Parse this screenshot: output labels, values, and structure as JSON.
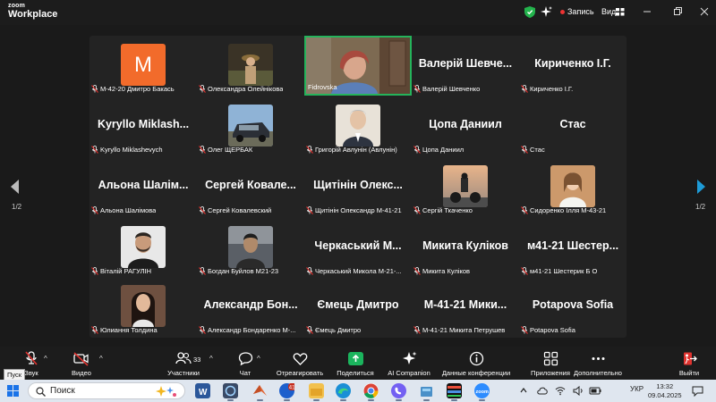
{
  "window": {
    "logo_small": "zoom",
    "logo_title": "Workplace",
    "recording_label": "Запись",
    "view_label": "Вид"
  },
  "gallery": {
    "page_indicator_left": "1/2",
    "page_indicator_right": "1/2",
    "tiles": [
      {
        "name": "М-42-20 Дмитро Бакась",
        "avatar": "letter",
        "letter": "M",
        "color": "#f26b2b"
      },
      {
        "name": "Олександра Олейнікова",
        "avatar": "photo-woman-hat"
      },
      {
        "name": "Fidrovska",
        "avatar": "video"
      },
      {
        "name": "Валерій Шевченко",
        "big": "Валерій Шевче..."
      },
      {
        "name": "Кириченко І.Г.",
        "big": "Кириченко І.Г."
      },
      {
        "name": "Kyryllo Miklashevych",
        "big": "Kyryllo Miklash..."
      },
      {
        "name": "Олег ЩЕРБАК",
        "avatar": "photo-car"
      },
      {
        "name": "Григорій Авлунін (Авлунін)",
        "avatar": "photo-man-grey"
      },
      {
        "name": "Цопа Даниил",
        "big": "Цопа Даниил"
      },
      {
        "name": "Стас",
        "big": "Стас"
      },
      {
        "name": "Альона Шалімова",
        "big": "Альона Шалім..."
      },
      {
        "name": "Сергей Ковалевский",
        "big": "Сергей Ковале..."
      },
      {
        "name": "Щитінін Олександр М-41-21",
        "big": "Щитінін Олекс..."
      },
      {
        "name": "Сергій Ткаченко",
        "avatar": "photo-moto"
      },
      {
        "name": "Сидоренко Ілля М-43-21",
        "avatar": "photo-girl"
      },
      {
        "name": "Віталій РАГУЛІН",
        "avatar": "photo-man-beard"
      },
      {
        "name": "Богдан Буйлов М21-23",
        "avatar": "photo-man-dark"
      },
      {
        "name": "Черкаський Микола М-21-...",
        "big": "Черкаський М..."
      },
      {
        "name": "Микита Куліков",
        "big": "Микита Куліков"
      },
      {
        "name": "м41-21 Шестерик Б О",
        "big": "м41-21 Шестер..."
      },
      {
        "name": "Юлиання Толдина",
        "avatar": "photo-woman-dark"
      },
      {
        "name": "Александр Бондаренко М-...",
        "big": "Александр Бон..."
      },
      {
        "name": "Ємець Дмитро",
        "big": "Ємець Дмитро"
      },
      {
        "name": "М-41-21 Микита Петрушев",
        "big": "М-41-21 Мики..."
      },
      {
        "name": "Potapova Sofia",
        "big": "Potapova Sofia"
      }
    ]
  },
  "toolbar": {
    "audio_label": "Звук",
    "video_label": "Видео",
    "participants_label": "Участники",
    "participants_count": "33",
    "chat_label": "Чат",
    "react_label": "Отреагировать",
    "share_label": "Поделиться",
    "ai_label": "AI Companion",
    "meeting_info_label": "Данные конференции",
    "apps_label": "Приложения",
    "more_label": "Дополнительно",
    "leave_label": "Выйти",
    "tooltip": "Пуск"
  },
  "taskbar": {
    "search_placeholder": "Поиск",
    "language": "УКР",
    "time": "13:32",
    "date": "09.04.2025",
    "badge_count": "41"
  },
  "colors": {
    "gallery_bg": "#232323",
    "active_speaker_border": "#25b35b",
    "mute_red": "#e0332f",
    "accent_blue": "#1e9bd7"
  }
}
